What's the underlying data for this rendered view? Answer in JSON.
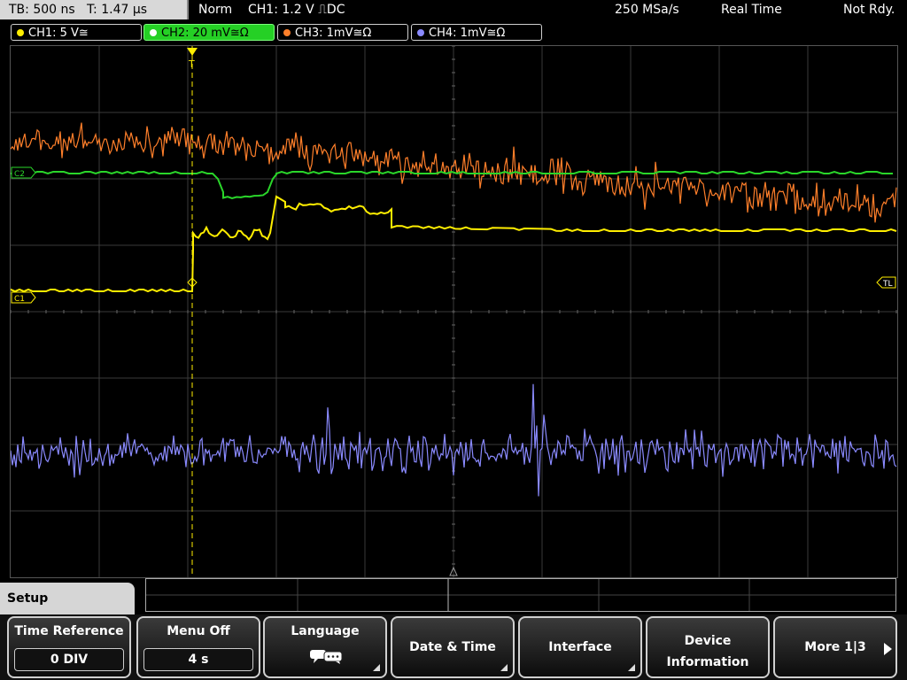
{
  "top": {
    "timebase": "TB: 500 ns",
    "trigger_time": "T: 1.47 µs",
    "mode": "Norm",
    "trigger_level": "CH1: 1.2 V ⎍DC",
    "sample_rate": "250 MSa/s",
    "acq_mode": "Real Time",
    "status": "Not Rdy."
  },
  "channels": [
    {
      "label": "CH1: 5 V≅",
      "color": "#ffee00",
      "active": false
    },
    {
      "label": "CH2: 20 mV≅Ω",
      "color": "#2ad62a",
      "active": true
    },
    {
      "label": "CH3: 1mV≅Ω",
      "color": "#ff7f2a",
      "active": false
    },
    {
      "label": "CH4: 1mV≅Ω",
      "color": "#8a8aff",
      "active": false
    }
  ],
  "markers": {
    "c1": "C1",
    "c2": "C2",
    "tl": "TL"
  },
  "menu": {
    "title": "Setup",
    "time_reference": "Time Reference",
    "time_reference_value": "0 DIV",
    "menu_off": "Menu Off",
    "menu_off_value": "4 s",
    "language": "Language",
    "date_time": "Date & Time",
    "interface": "Interface",
    "device_line1": "Device",
    "device_line2": "Information",
    "more": "More 1|3"
  },
  "icons": {
    "language": "speech-bubbles-icon",
    "more": "arrow-right-icon",
    "trigger": "trigger-position-icon"
  },
  "colors": {
    "ch1": "#ffee00",
    "ch2": "#2ad62a",
    "ch3": "#ff7f2a",
    "ch4": "#8a8aff",
    "grid": "#3a3a3a"
  }
}
